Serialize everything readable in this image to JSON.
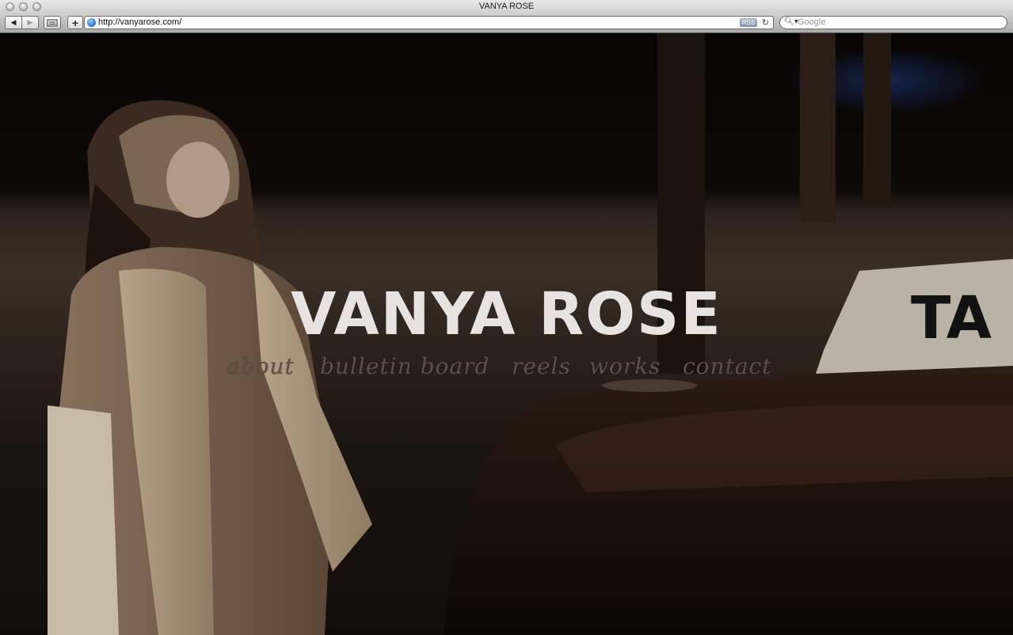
{
  "window": {
    "title": "VANYA ROSE"
  },
  "toolbar": {
    "back_icon": "back-arrow-icon",
    "forward_icon": "forward-arrow-icon",
    "show_all_bookmarks_icon": "bookmarks-icon",
    "add_bookmark_icon": "plus-icon",
    "url": "http://vanyarose.com/",
    "rss_label": "RSS",
    "reload_icon": "reload-icon",
    "search_placeholder": "Google"
  },
  "page": {
    "site_title": "VANYA ROSE",
    "nav": [
      {
        "label": "about"
      },
      {
        "label": "bulletin board"
      },
      {
        "label": "reels"
      },
      {
        "label": "works"
      },
      {
        "label": "contact"
      }
    ],
    "taxi_sign_text": "TA",
    "colors": {
      "title": "#e6e3e1",
      "nav": "#5f5048",
      "background": "#2b221b"
    }
  }
}
